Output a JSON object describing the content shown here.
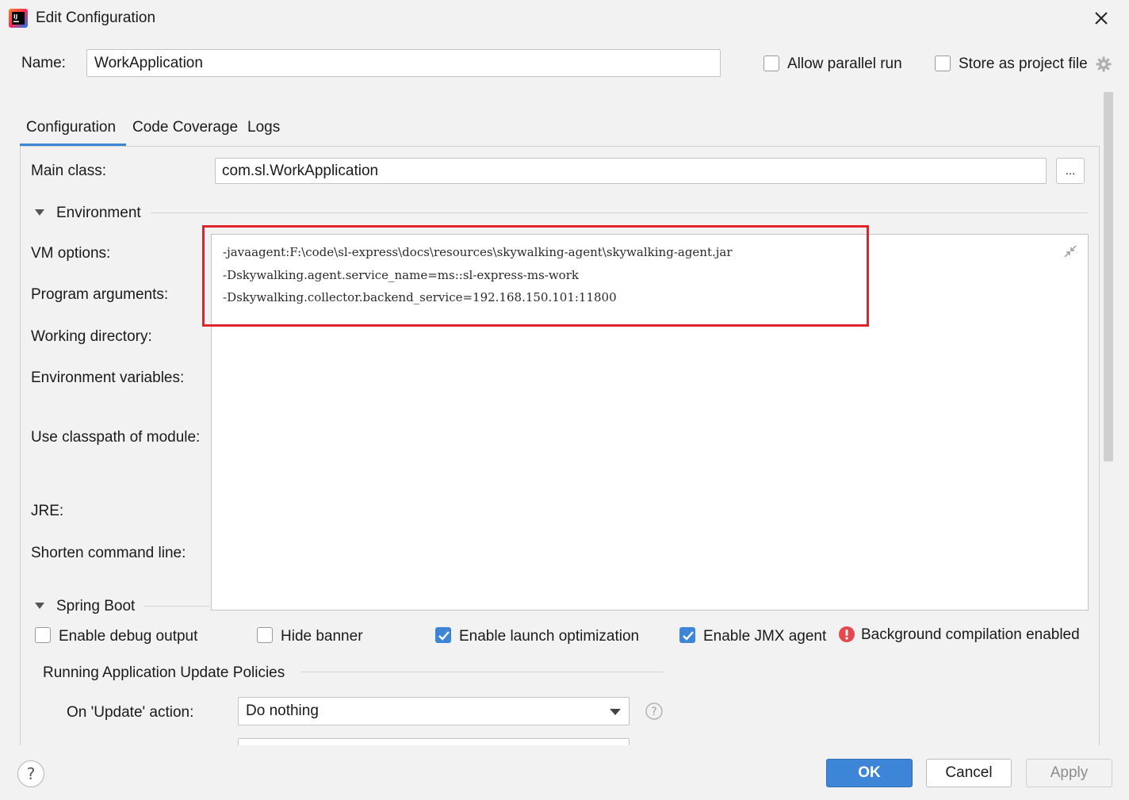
{
  "window": {
    "title": "Edit Configuration"
  },
  "header": {
    "name_label": "Name:",
    "name_value": "WorkApplication",
    "allow_parallel_label": "Allow parallel run",
    "allow_parallel_checked": false,
    "store_project_label": "Store as project file",
    "store_project_checked": false
  },
  "tabs": [
    {
      "label": "Configuration",
      "active": true
    },
    {
      "label": "Code Coverage",
      "active": false
    },
    {
      "label": "Logs",
      "active": false
    }
  ],
  "main_class": {
    "label": "Main class:",
    "value": "com.sl.WorkApplication",
    "browse_label": "..."
  },
  "environment": {
    "section_label": "Environment",
    "labels": {
      "vm_options": "VM options:",
      "program_arguments": "Program arguments:",
      "working_directory": "Working directory:",
      "environment_variables": "Environment variables:",
      "classpath_module": "Use classpath of module:",
      "jre": "JRE:",
      "shorten_command_line": "Shorten command line:"
    },
    "vm_options_lines": [
      "-javaagent:F:\\code\\sl-express\\docs\\resources\\skywalking-agent\\skywalking-agent.jar",
      "-Dskywalking.agent.service_name=ms::sl-express-ms-work",
      "-Dskywalking.collector.backend_service=192.168.150.101:11800"
    ]
  },
  "spring_boot": {
    "section_label": "Spring Boot",
    "enable_debug_output": {
      "label": "Enable debug output",
      "checked": false
    },
    "hide_banner": {
      "label": "Hide banner",
      "checked": false
    },
    "enable_launch_optimization": {
      "label": "Enable launch optimization",
      "checked": true
    },
    "enable_jmx_agent": {
      "label": "Enable JMX agent",
      "checked": true
    },
    "background_compilation": "Background compilation enabled",
    "update_policies_label": "Running Application Update Policies",
    "on_update_label": "On 'Update' action:",
    "on_update_value": "Do nothing"
  },
  "footer": {
    "ok_label": "OK",
    "cancel_label": "Cancel",
    "apply_label": "Apply"
  },
  "colors": {
    "accent": "#3d85d6",
    "highlight_box": "#e0242b",
    "error_icon": "#e5484d"
  }
}
